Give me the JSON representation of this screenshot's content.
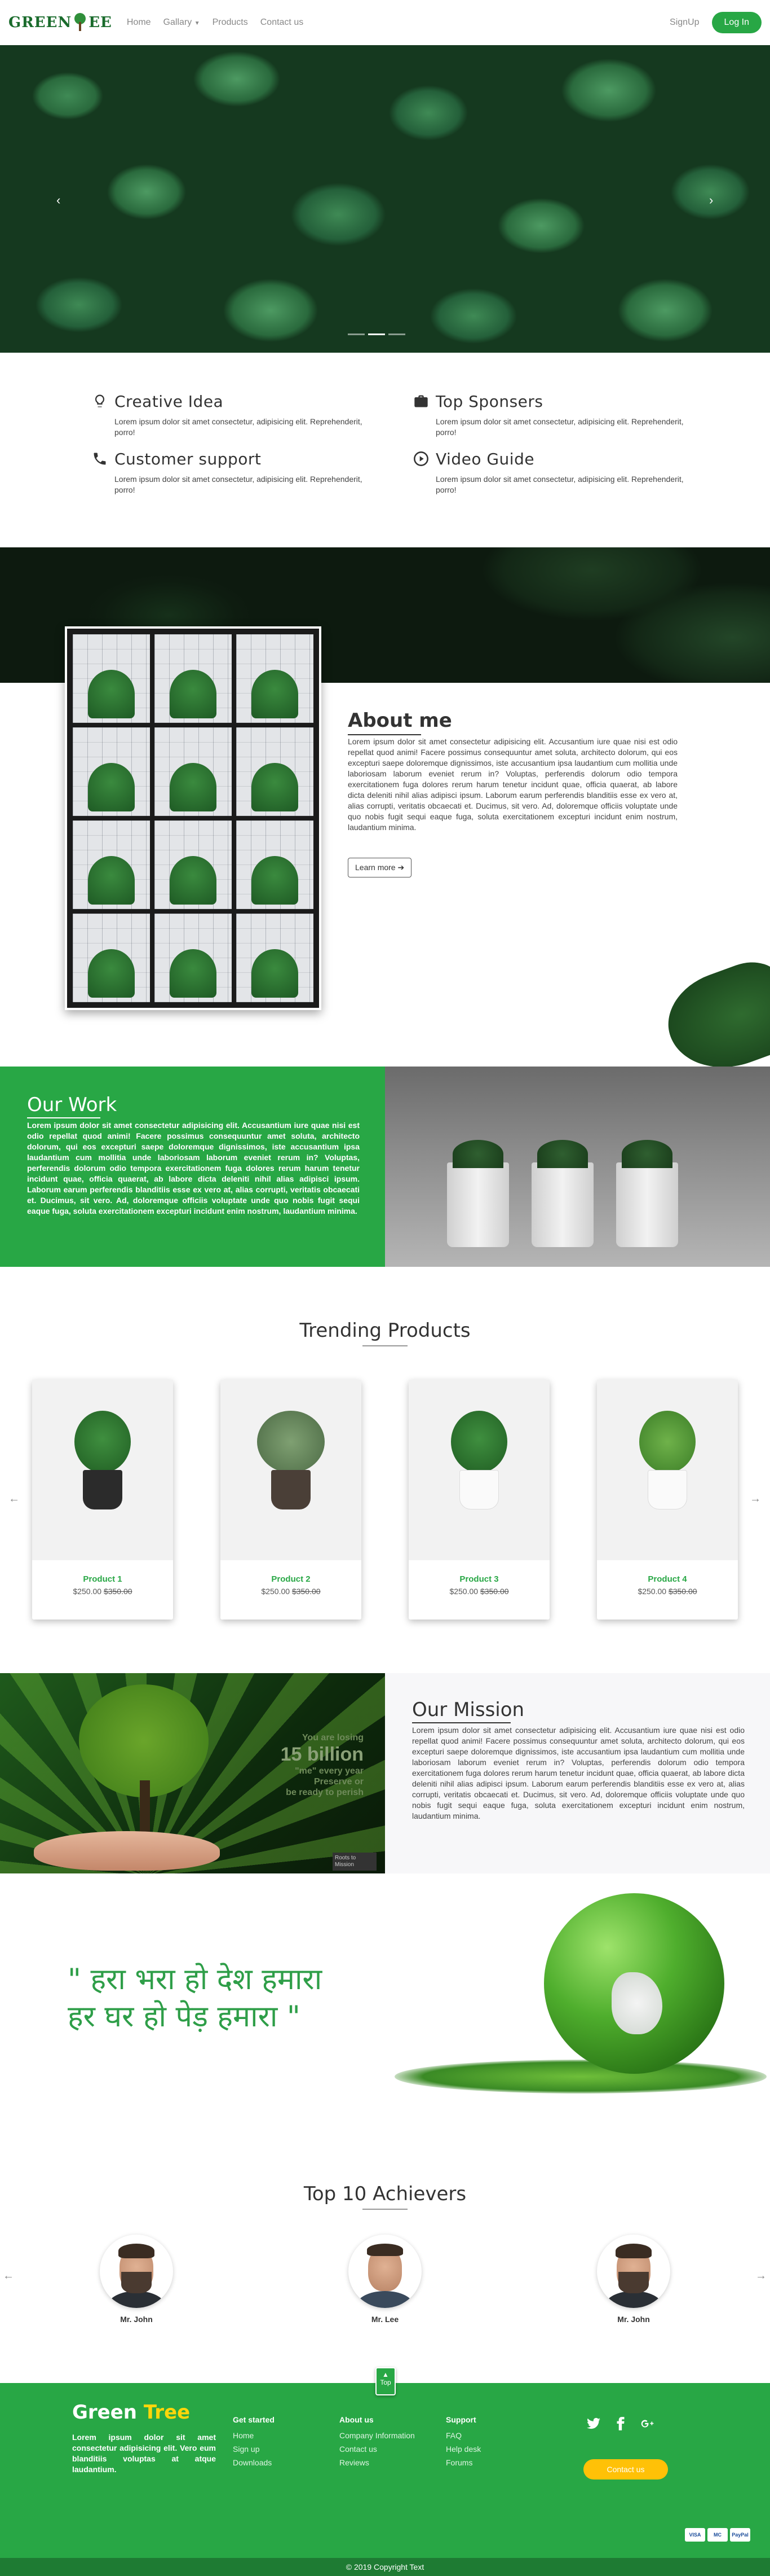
{
  "nav": {
    "logo": "GreenTree",
    "links": [
      "Home",
      "Gallary",
      "Products",
      "Contact us"
    ],
    "signup": "SignUp",
    "login": "Log In"
  },
  "hero": {
    "prev": "‹",
    "next": "›",
    "active_slide": 1,
    "slide_count": 3
  },
  "features": [
    {
      "title": "Creative Idea",
      "text": "Lorem ipsum dolor sit amet consectetur, adipisicing elit. Reprehenderit, porro!",
      "icon": "lightbulb-icon"
    },
    {
      "title": "Top Sponsers",
      "text": "Lorem ipsum dolor sit amet consectetur, adipisicing elit. Reprehenderit, porro!",
      "icon": "briefcase-icon"
    },
    {
      "title": "Customer support",
      "text": "Lorem ipsum dolor sit amet consectetur, adipisicing elit. Reprehenderit, porro!",
      "icon": "phone-icon"
    },
    {
      "title": "Video Guide",
      "text": "Lorem ipsum dolor sit amet consectetur, adipisicing elit. Reprehenderit, porro!",
      "icon": "play-circle-icon"
    }
  ],
  "about": {
    "title": "About me",
    "text": "Lorem ipsum dolor sit amet consectetur adipisicing elit. Accusantium iure quae nisi est odio repellat quod animi! Facere possimus consequuntur amet soluta, architecto dolorum, qui eos excepturi saepe doloremque dignissimos, iste accusantium ipsa laudantium cum mollitia unde laboriosam laborum eveniet rerum in? Voluptas, perferendis dolorum odio tempora exercitationem fuga dolores rerum harum tenetur incidunt quae, officia quaerat, ab labore dicta deleniti nihil alias adipisci ipsum. Laborum earum perferendis blanditiis esse ex vero at, alias corrupti, veritatis obcaecati et. Ducimus, sit vero. Ad, doloremque officiis voluptate unde quo nobis fugit sequi eaque fuga, soluta exercitationem excepturi incidunt enim nostrum, laudantium minima.",
    "button": "Learn more"
  },
  "work": {
    "title": "Our Work",
    "text": "Lorem ipsum dolor sit amet consectetur adipisicing elit. Accusantium iure quae nisi est odio repellat quod animi! Facere possimus consequuntur amet soluta, architecto dolorum, qui eos excepturi saepe doloremque dignissimos, iste accusantium ipsa laudantium cum mollitia unde laboriosam laborum eveniet rerum in? Voluptas, perferendis dolorum odio tempora exercitationem fuga dolores rerum harum tenetur incidunt quae, officia quaerat, ab labore dicta deleniti nihil alias adipisci ipsum. Laborum earum perferendis blanditiis esse ex vero at, alias corrupti, veritatis obcaecati et. Ducimus, sit vero. Ad, doloremque officiis voluptate unde quo nobis fugit sequi eaque fuga, soluta exercitationem excepturi incidunt enim nostrum, laudantium minima."
  },
  "trending": {
    "title": "Trending Products",
    "prev": "←",
    "next": "→",
    "products": [
      {
        "name": "Product 1",
        "price": "$250.00",
        "old_price": "$350.00"
      },
      {
        "name": "Product 2",
        "price": "$250.00",
        "old_price": "$350.00"
      },
      {
        "name": "Product 3",
        "price": "$250.00",
        "old_price": "$350.00"
      },
      {
        "name": "Product 4",
        "price": "$250.00",
        "old_price": "$350.00"
      }
    ]
  },
  "mission": {
    "title": "Our Mission",
    "image_text": {
      "line1": "You are losing",
      "big": "15 billion",
      "line2": "\"me\" every year",
      "line3": "Preserve or",
      "line4": "be ready to perish",
      "badge": "Roots to Mission"
    },
    "text": "Lorem ipsum dolor sit amet consectetur adipisicing elit. Accusantium iure quae nisi est odio repellat quod animi! Facere possimus consequuntur amet soluta, architecto dolorum, qui eos excepturi saepe doloremque dignissimos, iste accusantium ipsa laudantium cum mollitia unde laboriosam laborum eveniet rerum in? Voluptas, perferendis dolorum odio tempora exercitationem fuga dolores rerum harum tenetur incidunt quae, officia quaerat, ab labore dicta deleniti nihil alias adipisci ipsum. Laborum earum perferendis blanditiis esse ex vero at, alias corrupti, veritatis obcaecati et. Ducimus, sit vero. Ad, doloremque officiis voluptate unde quo nobis fugit sequi eaque fuga, soluta exercitationem excepturi incidunt enim nostrum, laudantium minima."
  },
  "quote": {
    "line1": "\" हरा भरा हो देश हमारा",
    "line2": "हर घर हो पेड़ हमारा \""
  },
  "achievers": {
    "title": "Top 10 Achievers",
    "prev": "←",
    "next": "→",
    "people": [
      {
        "name": "Mr. John"
      },
      {
        "name": "Mr. Lee"
      },
      {
        "name": "Mr. John"
      }
    ]
  },
  "footer": {
    "top_label": "Top",
    "brand_1": "Green ",
    "brand_2": "Tree",
    "desc": "Lorem ipsum dolor sit amet consectetur adipisicing elit. Vero eum blanditiis voluptas at atque laudantium.",
    "cols": [
      {
        "title": "Get started",
        "items": [
          "Home",
          "Sign up",
          "Downloads"
        ]
      },
      {
        "title": "About us",
        "items": [
          "Company Information",
          "Contact us",
          "Reviews"
        ]
      },
      {
        "title": "Support",
        "items": [
          "FAQ",
          "Help desk",
          "Forums"
        ]
      }
    ],
    "contact": "Contact us",
    "payments": [
      "VISA",
      "MC",
      "PayPal"
    ],
    "copyright": "© 2019 Copyright Text"
  },
  "colors": {
    "brand_green": "#28a745",
    "accent_yellow": "#ffc107"
  }
}
